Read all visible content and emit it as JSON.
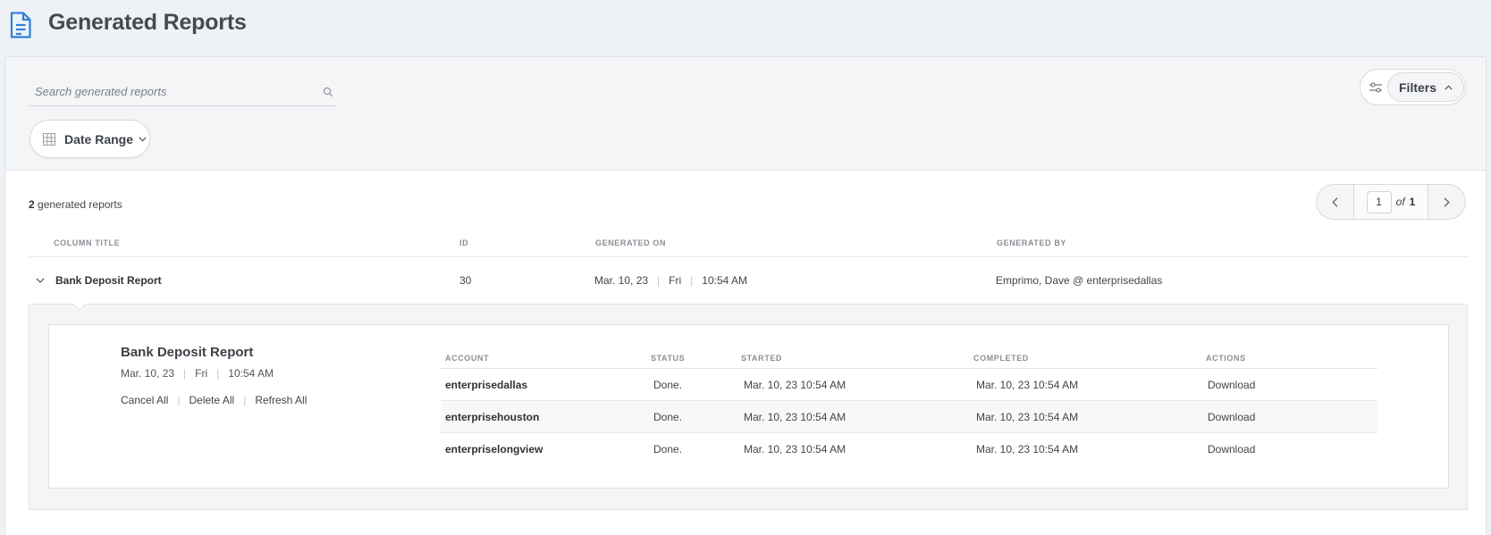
{
  "header": {
    "title": "Generated Reports",
    "icon": "document-icon"
  },
  "search": {
    "placeholder": "Search generated reports"
  },
  "filters": {
    "date_range_label": "Date Range",
    "filters_label": "Filters"
  },
  "summary": {
    "count": "2",
    "count_suffix": "generated reports"
  },
  "pagination": {
    "current_page": "1",
    "of_label": "of",
    "total_pages": "1"
  },
  "table": {
    "columns": {
      "title": "COLUMN TITLE",
      "id": "ID",
      "generated_on": "GENERATED ON",
      "generated_by": "GENERATED BY"
    },
    "rows": [
      {
        "title": "Bank Deposit Report",
        "id": "30",
        "date": "Mar. 10, 23",
        "day": "Fri",
        "time": "10:54 AM",
        "generated_by": "Emprimo, Dave @ enterprisedallas"
      }
    ]
  },
  "detail": {
    "title": "Bank Deposit Report",
    "date": "Mar. 10, 23",
    "day": "Fri",
    "time": "10:54 AM",
    "actions": {
      "cancel": "Cancel All",
      "delete": "Delete All",
      "refresh": "Refresh All"
    },
    "columns": {
      "account": "ACCOUNT",
      "status": "STATUS",
      "started": "STARTED",
      "completed": "COMPLETED",
      "actions": "ACTIONS"
    },
    "rows": [
      {
        "account": "enterprisedallas",
        "status": "Done.",
        "started": "Mar. 10, 23 10:54 AM",
        "completed": "Mar. 10, 23 10:54 AM",
        "action": "Download"
      },
      {
        "account": "enterprisehouston",
        "status": "Done.",
        "started": "Mar. 10, 23 10:54 AM",
        "completed": "Mar. 10, 23 10:54 AM",
        "action": "Download"
      },
      {
        "account": "enterpriselongview",
        "status": "Done.",
        "started": "Mar. 10, 23 10:54 AM",
        "completed": "Mar. 10, 23 10:54 AM",
        "action": "Download"
      }
    ]
  },
  "colors": {
    "accent": "#2f7fd8",
    "background": "#eef1f5",
    "panel": "#ffffff"
  }
}
